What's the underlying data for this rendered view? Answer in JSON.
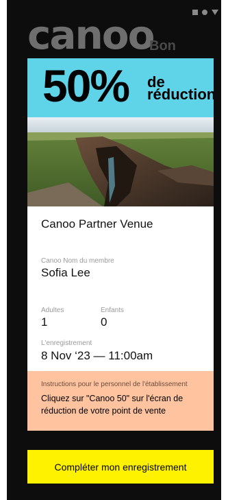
{
  "brand": {
    "name": "canoo",
    "sub": "Bon"
  },
  "offer": {
    "percent": "50%",
    "line1": "de",
    "line2": "réduction"
  },
  "venue": "Canoo Partner Venue",
  "member": {
    "label": "Canoo Nom du membre",
    "name": "Sofia Lee"
  },
  "party": {
    "adults_label": "Adultes",
    "adults": "1",
    "children_label": "Enfants",
    "children": "0"
  },
  "checkin": {
    "label": "L'enregistrement",
    "datetime": "8 Nov ‘23 — 11:00am"
  },
  "instructions": {
    "label": "Instructions pour le personnel de l'établissement",
    "text": "Cliquez sur \"Canoo 50\" sur l'écran de réduction de votre point de vente"
  },
  "cta": "Compléter mon enregistrement",
  "colors": {
    "banner": "#5fd3e8",
    "instructions": "#ffc3a0",
    "cta": "#fff200",
    "background": "#0d0d0d"
  },
  "icons": [
    "square-icon",
    "circle-icon",
    "triangle-down-icon"
  ]
}
